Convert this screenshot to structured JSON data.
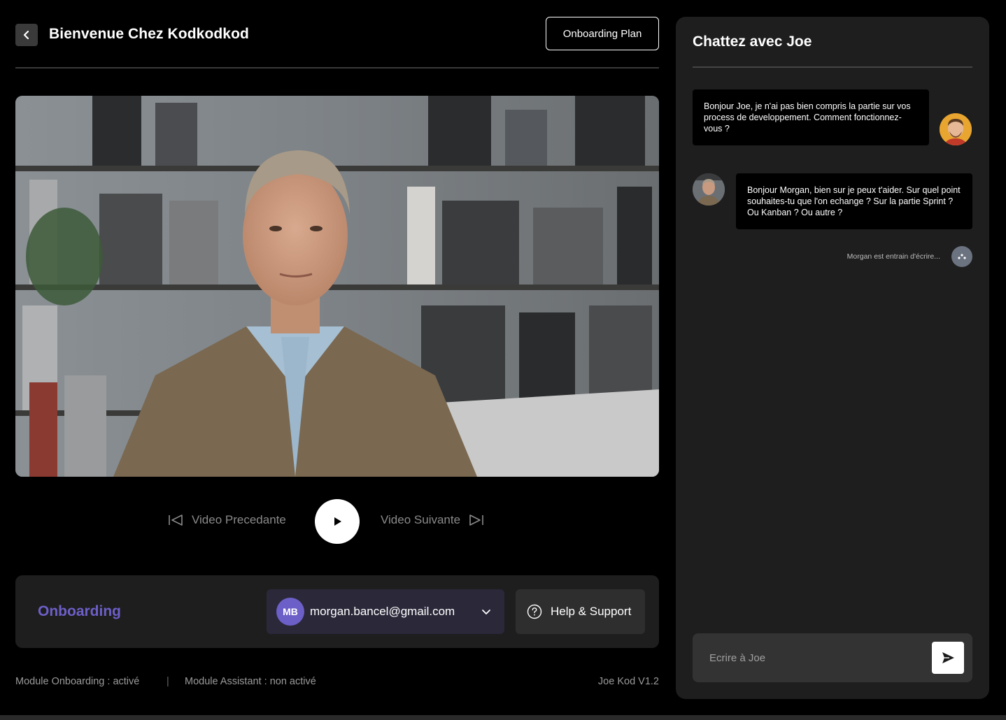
{
  "header": {
    "title": "Bienvenue Chez Kodkodkod",
    "plan_button": "Onboarding Plan"
  },
  "video": {
    "description": "Man in tweed jacket seated in front of bookshelves"
  },
  "controls": {
    "prev_label": "Video Precedante",
    "next_label": "Video Suivante"
  },
  "bottom_card": {
    "section_label": "Onboarding",
    "account": {
      "initials": "MB",
      "email": "morgan.bancel@gmail.com"
    },
    "help_label": "Help & Support"
  },
  "footer": {
    "module_onboarding": "Module Onboarding : activé",
    "separator": "|",
    "module_assistant": "Module Assistant : non activé",
    "version": "Joe Kod V1.2"
  },
  "chat": {
    "title": "Chattez avec Joe",
    "messages": [
      {
        "author": "Morgan",
        "text": "Bonjour Joe, je n'ai pas bien compris la partie sur vos process de developpement. Comment fonctionnez-vous ?"
      },
      {
        "author": "Joe",
        "text": "Bonjour Morgan, bien sur je peux t'aider. Sur quel point souhaites-tu que l'on echange ? Sur la partie Sprint ? Ou Kanban ? Ou autre ?"
      }
    ],
    "typing_indicator": "Morgan est entrain d'écrire...",
    "input_placeholder": "Ecrire à Joe"
  },
  "colors": {
    "accent": "#6c5fc7",
    "background": "#000000",
    "panel": "#1e1e1e"
  }
}
